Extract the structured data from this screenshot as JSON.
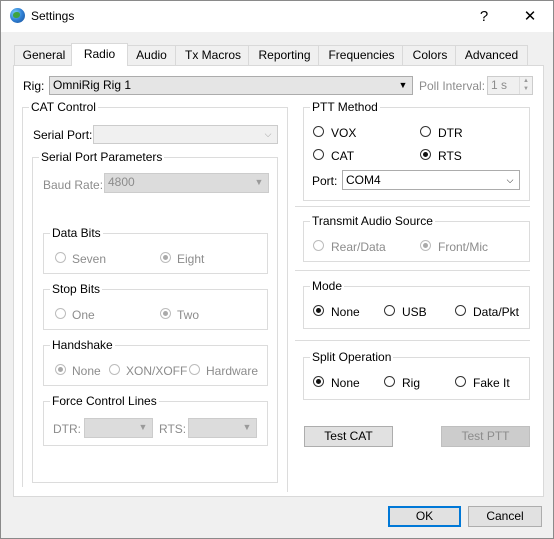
{
  "window": {
    "title": "Settings",
    "help_label": "?",
    "close_label": "✕"
  },
  "tabs": [
    "General",
    "Radio",
    "Audio",
    "Tx Macros",
    "Reporting",
    "Frequencies",
    "Colors",
    "Advanced"
  ],
  "radio": {
    "rig_label": "Rig:",
    "rig_value": "OmniRig Rig 1",
    "poll_interval_label": "Poll Interval:",
    "poll_interval_value": "1 s"
  },
  "cat_control": {
    "title": "CAT Control",
    "serial_port_label": "Serial Port:",
    "serial_port_value": "",
    "serial_params_title": "Serial Port Parameters",
    "baud_rate_label": "Baud Rate:",
    "baud_rate_value": "4800",
    "data_bits": {
      "title": "Data Bits",
      "options": [
        "Seven",
        "Eight"
      ],
      "selected": "Eight"
    },
    "stop_bits": {
      "title": "Stop Bits",
      "options": [
        "One",
        "Two"
      ],
      "selected": "Two"
    },
    "handshake": {
      "title": "Handshake",
      "options": [
        "None",
        "XON/XOFF",
        "Hardware"
      ],
      "selected": "None"
    },
    "force_control": {
      "title": "Force Control Lines",
      "dtr_label": "DTR:",
      "dtr_value": "",
      "rts_label": "RTS:",
      "rts_value": ""
    }
  },
  "ptt_method": {
    "title": "PTT Method",
    "options": [
      "VOX",
      "DTR",
      "CAT",
      "RTS"
    ],
    "selected": "RTS",
    "port_label": "Port:",
    "port_value": "COM4"
  },
  "transmit_audio_source": {
    "title": "Transmit Audio Source",
    "options": [
      "Rear/Data",
      "Front/Mic"
    ],
    "selected": "Front/Mic"
  },
  "mode": {
    "title": "Mode",
    "options": [
      "None",
      "USB",
      "Data/Pkt"
    ],
    "selected": "None"
  },
  "split_operation": {
    "title": "Split Operation",
    "options": [
      "None",
      "Rig",
      "Fake It"
    ],
    "selected": "None"
  },
  "buttons": {
    "test_cat": "Test CAT",
    "test_ptt": "Test PTT",
    "ok": "OK",
    "cancel": "Cancel"
  },
  "colors": {
    "accent": "#0078d7",
    "disabled_text": "#8c8c8c"
  }
}
